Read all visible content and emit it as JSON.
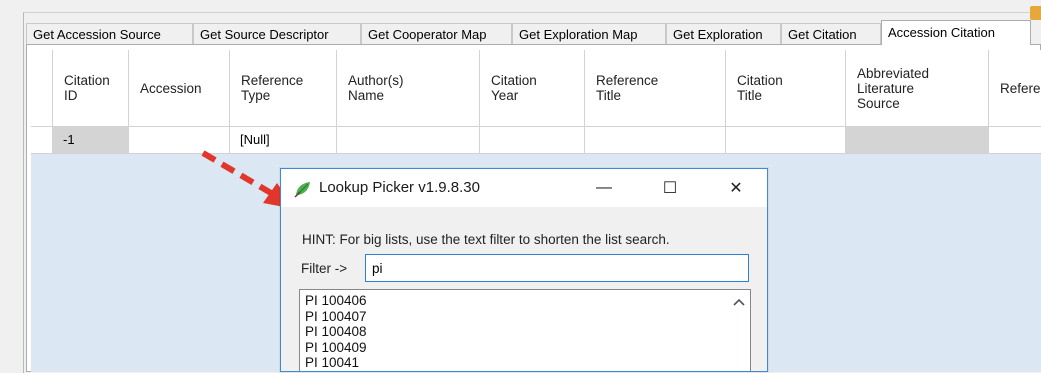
{
  "tabs": [
    {
      "label": "Get Accession Source",
      "active": false
    },
    {
      "label": "Get Source Descriptor",
      "active": false
    },
    {
      "label": "Get Cooperator Map",
      "active": false
    },
    {
      "label": "Get Exploration Map",
      "active": false
    },
    {
      "label": "Get Exploration",
      "active": false
    },
    {
      "label": "Get Citation",
      "active": false
    },
    {
      "label": "Accession Citation",
      "active": true
    }
  ],
  "grid": {
    "columns": [
      {
        "label": "Citation\nID"
      },
      {
        "label": "Accession"
      },
      {
        "label": "Reference\nType"
      },
      {
        "label": "Author(s)\nName"
      },
      {
        "label": "Citation\nYear"
      },
      {
        "label": "Reference\nTitle"
      },
      {
        "label": "Citation\nTitle"
      },
      {
        "label": "Abbreviated\nLiterature\nSource"
      },
      {
        "label": "Refere"
      }
    ],
    "row": [
      "-1",
      "",
      "[Null]",
      "",
      "",
      "",
      "",
      "",
      ""
    ]
  },
  "dialog": {
    "title": "Lookup Picker v1.9.8.30",
    "minimize_glyph": "—",
    "maximize_glyph": "☐",
    "close_glyph": "✕",
    "hint": "HINT: For big lists, use the text filter to shorten the list search.",
    "filter_label": "Filter ->",
    "filter_value": "pi",
    "list_items": [
      "PI 100406",
      "PI 100407",
      "PI 100408",
      "PI 100409",
      "PI 10041"
    ],
    "scroll_up_icon": "chevron-up-icon"
  },
  "colors": {
    "accent_blue": "#3f8ad6",
    "grid_background": "#dbe7f3",
    "arrow_red": "#e0362c",
    "icon_green": "#4caf50"
  }
}
